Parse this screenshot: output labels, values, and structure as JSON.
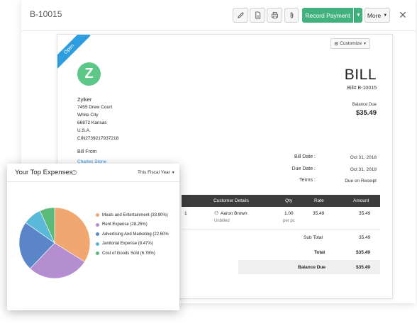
{
  "topbar": {
    "bill_id": "B-10015",
    "record_payment_label": "Record Payment",
    "more_label": "More"
  },
  "document": {
    "status_ribbon": "Open",
    "customize_label": "Customize",
    "logo_letter": "Z",
    "org": {
      "name": "Zylker",
      "address_lines": [
        "7455 Drew Court",
        "White City",
        "66872 Kansas",
        "U.S.A.",
        "CIN2739217937218"
      ]
    },
    "title": "BILL",
    "bill_number": "Bill# B-10015",
    "balance_due_label": "Balance Due",
    "balance_due_value": "$35.49",
    "bill_from_label": "Bill From",
    "vendor_name": "Charles Stone",
    "meta": [
      {
        "label": "Bill Date :",
        "value": "Oct 31, 2018"
      },
      {
        "label": "Due Date :",
        "value": "Oct 31, 2018"
      },
      {
        "label": "Terms :",
        "value": "Due on Receipt"
      }
    ],
    "table": {
      "headers": {
        "customer": "Customer Details",
        "qty": "Qty",
        "rate": "Rate",
        "amount": "Amount"
      },
      "rows": [
        {
          "index": "1",
          "customer": "Aaron Brown",
          "status": "Unbilled",
          "qty": "1.00",
          "unit": "per pc",
          "rate": "35.49",
          "amount": "35.49"
        }
      ]
    },
    "totals": {
      "subtotal_label": "Sub Total",
      "subtotal_value": "35.49",
      "total_label": "Total",
      "total_value": "$35.49",
      "balance_label": "Balance Due",
      "balance_value": "$35.49"
    }
  },
  "expenses": {
    "title": "Your Top Expenses",
    "period": "This Fiscal Year",
    "legend": [
      {
        "label": "Meals and Entertainment (33.90%)",
        "color": "#f0a870"
      },
      {
        "label": "Rent Expense (28.25%)",
        "color": "#b48ed0"
      },
      {
        "label": "Advertising And Marketing (22.60%",
        "color": "#5a85c8"
      },
      {
        "label": "Janitorial Expense (8.47%)",
        "color": "#5ab8d8"
      },
      {
        "label": "Cost of Goods Sold (6.78%)",
        "color": "#5bbb7a"
      }
    ]
  },
  "chart_data": {
    "type": "pie",
    "categories": [
      "Meals and Entertainment",
      "Rent Expense",
      "Advertising And Marketing",
      "Janitorial Expense",
      "Cost of Goods Sold"
    ],
    "values": [
      33.9,
      28.25,
      22.6,
      8.47,
      6.78
    ],
    "colors": [
      "#f0a870",
      "#b48ed0",
      "#5a85c8",
      "#5ab8d8",
      "#5bbb7a"
    ],
    "legend": "right"
  }
}
